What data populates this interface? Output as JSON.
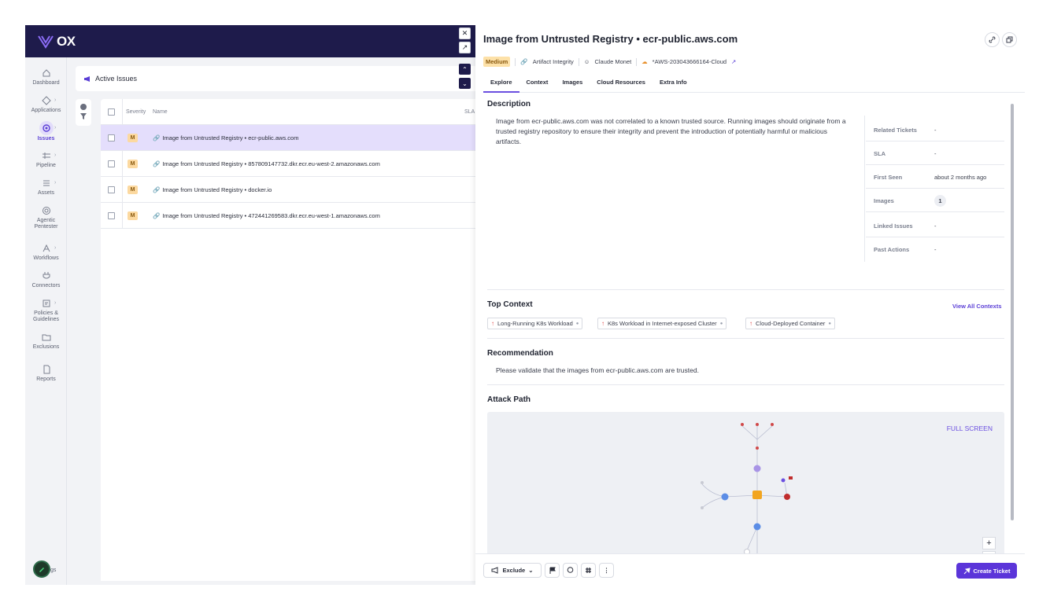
{
  "app": {
    "brand": "OX"
  },
  "sidebar": {
    "items": [
      {
        "label": "Dashboard",
        "icon": "home-icon"
      },
      {
        "label": "Applications",
        "icon": "applications-icon"
      },
      {
        "label": "Issues",
        "icon": "issues-icon",
        "active": true
      },
      {
        "label": "Pipeline",
        "icon": "pipeline-icon"
      },
      {
        "label": "Assets",
        "icon": "assets-icon"
      },
      {
        "label": "Agentic Pentester",
        "icon": "pentester-icon"
      },
      {
        "label": "Workflows",
        "icon": "workflows-icon"
      },
      {
        "label": "Connectors",
        "icon": "connectors-icon"
      },
      {
        "label": "Policies & Guidelines",
        "icon": "policies-icon"
      },
      {
        "label": "Exclusions",
        "icon": "exclusions-icon"
      },
      {
        "label": "Reports",
        "icon": "reports-icon"
      }
    ],
    "settings_label": "gs"
  },
  "issues_header": {
    "title": "Active Issues"
  },
  "table": {
    "columns": {
      "severity": "Severity",
      "name": "Name",
      "sla": "SLA"
    },
    "rows": [
      {
        "severity": "M",
        "name": "Image from Untrusted Registry • ecr-public.aws.com",
        "selected": true
      },
      {
        "severity": "M",
        "name": "Image from Untrusted Registry • 857809147732.dkr.ecr.eu-west-2.amazonaws.com"
      },
      {
        "severity": "M",
        "name": "Image from Untrusted Registry • docker.io"
      },
      {
        "severity": "M",
        "name": "Image from Untrusted Registry • 472441269583.dkr.ecr.eu-west-1.amazonaws.com"
      }
    ]
  },
  "detail": {
    "title": "Image from Untrusted Registry • ecr-public.aws.com",
    "severity": "Medium",
    "category": "Artifact Integrity",
    "owner": "Claude Monet",
    "cloud_account": "*AWS-203043666164-Cloud",
    "tabs": [
      "Explore",
      "Context",
      "Images",
      "Cloud Resources",
      "Extra Info"
    ],
    "active_tab": "Explore",
    "description_title": "Description",
    "description": "Image from ecr-public.aws.com was not correlated to a known trusted source. Running images should originate from a trusted registry repository to ensure their integrity and prevent the introduction of potentially harmful or malicious artifacts.",
    "info": [
      {
        "key": "Related Tickets",
        "value": "-"
      },
      {
        "key": "SLA",
        "value": "-"
      },
      {
        "key": "First Seen",
        "value": "about 2 months ago"
      },
      {
        "key": "Images",
        "value": "1"
      },
      {
        "key": "Linked Issues",
        "value": "-"
      },
      {
        "key": "Past Actions",
        "value": "-"
      }
    ],
    "top_context_title": "Top Context",
    "view_all": "View All Contexts",
    "contexts": [
      "Long-Running K8s Workload",
      "K8s Workload in Internet-exposed Cluster",
      "Cloud-Deployed Container"
    ],
    "recommendation_title": "Recommendation",
    "recommendation": "Please validate that the images from ecr-public.aws.com are trusted.",
    "attack_path_title": "Attack Path",
    "fullscreen": "FULL SCREEN",
    "zoom_in": "+",
    "zoom_out": "−"
  },
  "footer": {
    "exclude": "Exclude",
    "create_ticket": "Create Ticket"
  },
  "colors": {
    "brand_dark": "#1e1b4b",
    "accent": "#5b35d9",
    "medium": "#fde1a8",
    "selected_row": "#e4defc"
  }
}
